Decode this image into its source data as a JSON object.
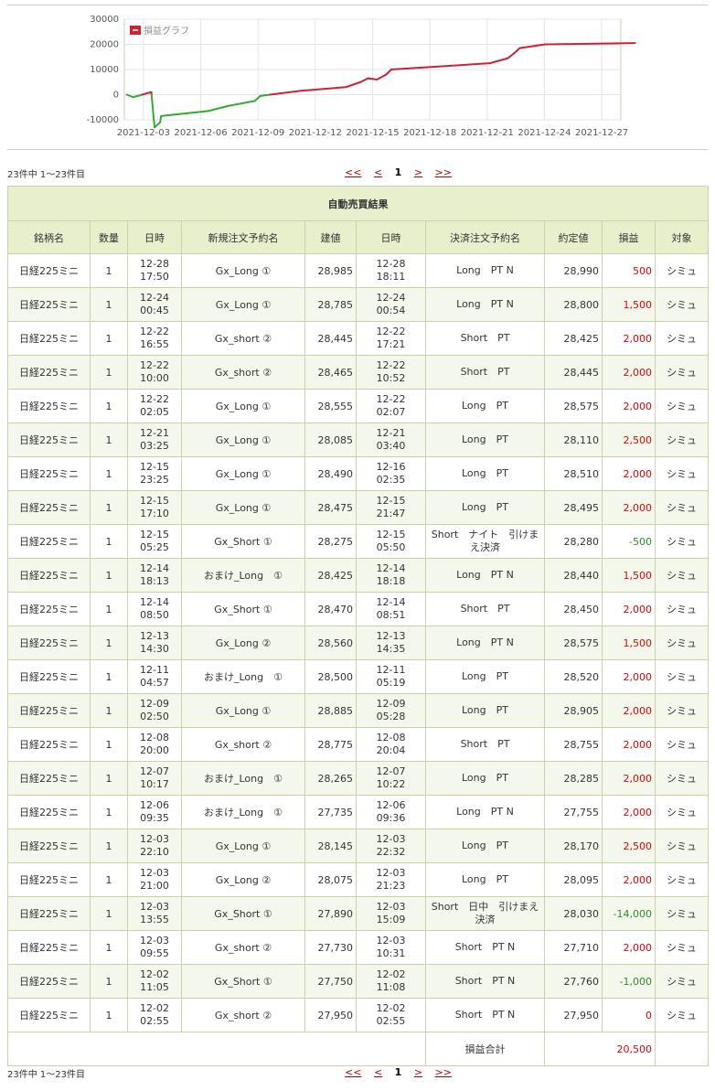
{
  "chart_data": {
    "type": "line",
    "legend": "損益グラフ",
    "legend_position": "top-left",
    "ylim": [
      -10000,
      30000
    ],
    "yticks": [
      30000,
      20000,
      10000,
      0,
      -10000
    ],
    "ytick_labels": [
      "30000",
      "20000",
      "10000",
      "0",
      "-10000"
    ],
    "xticks": [
      "2021-12-03",
      "2021-12-06",
      "2021-12-09",
      "2021-12-12",
      "2021-12-15",
      "2021-12-18",
      "2021-12-21",
      "2021-12-24",
      "2021-12-27"
    ],
    "xlim": [
      "2021-12-02",
      "2021-12-28"
    ],
    "series": [
      {
        "name": "損益グラフ",
        "points": [
          [
            "2021-12-02 02:55",
            0
          ],
          [
            "2021-12-02 11:05",
            -1000
          ],
          [
            "2021-12-03 09:55",
            1000
          ],
          [
            "2021-12-03 13:55",
            -13000
          ],
          [
            "2021-12-03 21:00",
            -11000
          ],
          [
            "2021-12-03 22:10",
            -8500
          ],
          [
            "2021-12-06 09:35",
            -6500
          ],
          [
            "2021-12-07 10:17",
            -4500
          ],
          [
            "2021-12-08 20:00",
            -2500
          ],
          [
            "2021-12-09 02:50",
            -500
          ],
          [
            "2021-12-11 04:57",
            1500
          ],
          [
            "2021-12-13 14:30",
            3000
          ],
          [
            "2021-12-14 08:50",
            5000
          ],
          [
            "2021-12-14 18:13",
            6500
          ],
          [
            "2021-12-15 05:25",
            6000
          ],
          [
            "2021-12-15 17:10",
            8000
          ],
          [
            "2021-12-15 23:25",
            10000
          ],
          [
            "2021-12-21 03:25",
            12500
          ],
          [
            "2021-12-22 02:05",
            14500
          ],
          [
            "2021-12-22 10:00",
            16500
          ],
          [
            "2021-12-22 16:55",
            18500
          ],
          [
            "2021-12-24 00:45",
            20000
          ],
          [
            "2021-12-28 17:50",
            20500
          ]
        ],
        "color_negative": "#33aa33",
        "color_positive": "#cc2233"
      }
    ],
    "grid": true
  },
  "pager": {
    "count_text": "23件中 1～23件目",
    "first": "<<",
    "prev": "<",
    "current": "1",
    "next": ">",
    "last": ">>"
  },
  "table": {
    "title": "自動売買結果",
    "headers": [
      "銘柄名",
      "数量",
      "日時",
      "新規注文予約名",
      "建値",
      "日時",
      "決済注文予約名",
      "約定値",
      "損益",
      "対象"
    ],
    "rows": [
      [
        "日経225ミニ",
        "1",
        "12-28\n17:50",
        "Gx_Long ①",
        "28,985",
        "12-28\n18:11",
        "Long　PT N",
        "28,990",
        "500",
        "シミュ"
      ],
      [
        "日経225ミニ",
        "1",
        "12-24\n00:45",
        "Gx_Long ①",
        "28,785",
        "12-24\n00:54",
        "Long　PT N",
        "28,800",
        "1,500",
        "シミュ"
      ],
      [
        "日経225ミニ",
        "1",
        "12-22\n16:55",
        "Gx_short ②",
        "28,445",
        "12-22\n17:21",
        "Short　PT",
        "28,425",
        "2,000",
        "シミュ"
      ],
      [
        "日経225ミニ",
        "1",
        "12-22\n10:00",
        "Gx_short ②",
        "28,465",
        "12-22\n10:52",
        "Short　PT",
        "28,445",
        "2,000",
        "シミュ"
      ],
      [
        "日経225ミニ",
        "1",
        "12-22\n02:05",
        "Gx_Long ①",
        "28,555",
        "12-22\n02:07",
        "Long　PT",
        "28,575",
        "2,000",
        "シミュ"
      ],
      [
        "日経225ミニ",
        "1",
        "12-21\n03:25",
        "Gx_Long ①",
        "28,085",
        "12-21\n03:40",
        "Long　PT",
        "28,110",
        "2,500",
        "シミュ"
      ],
      [
        "日経225ミニ",
        "1",
        "12-15\n23:25",
        "Gx_Long ①",
        "28,490",
        "12-16\n02:35",
        "Long　PT",
        "28,510",
        "2,000",
        "シミュ"
      ],
      [
        "日経225ミニ",
        "1",
        "12-15\n17:10",
        "Gx_Long ①",
        "28,475",
        "12-15\n21:47",
        "Long　PT",
        "28,495",
        "2,000",
        "シミュ"
      ],
      [
        "日経225ミニ",
        "1",
        "12-15\n05:25",
        "Gx_Short ①",
        "28,275",
        "12-15\n05:50",
        "Short　ナイト　引けま\nえ決済",
        "28,280",
        "-500",
        "シミュ"
      ],
      [
        "日経225ミニ",
        "1",
        "12-14\n18:13",
        "おまけ_Long　①",
        "28,425",
        "12-14\n18:18",
        "Long　PT N",
        "28,440",
        "1,500",
        "シミュ"
      ],
      [
        "日経225ミニ",
        "1",
        "12-14\n08:50",
        "Gx_Short ①",
        "28,470",
        "12-14\n08:51",
        "Short　PT",
        "28,450",
        "2,000",
        "シミュ"
      ],
      [
        "日経225ミニ",
        "1",
        "12-13\n14:30",
        "Gx_Long ②",
        "28,560",
        "12-13\n14:35",
        "Long　PT N",
        "28,575",
        "1,500",
        "シミュ"
      ],
      [
        "日経225ミニ",
        "1",
        "12-11\n04:57",
        "おまけ_Long　①",
        "28,500",
        "12-11\n05:19",
        "Long　PT",
        "28,520",
        "2,000",
        "シミュ"
      ],
      [
        "日経225ミニ",
        "1",
        "12-09\n02:50",
        "Gx_Long ①",
        "28,885",
        "12-09\n05:28",
        "Long　PT",
        "28,905",
        "2,000",
        "シミュ"
      ],
      [
        "日経225ミニ",
        "1",
        "12-08\n20:00",
        "Gx_short ②",
        "28,775",
        "12-08\n20:04",
        "Short　PT",
        "28,755",
        "2,000",
        "シミュ"
      ],
      [
        "日経225ミニ",
        "1",
        "12-07\n10:17",
        "おまけ_Long　①",
        "28,265",
        "12-07\n10:22",
        "Long　PT",
        "28,285",
        "2,000",
        "シミュ"
      ],
      [
        "日経225ミニ",
        "1",
        "12-06\n09:35",
        "おまけ_Long　①",
        "27,735",
        "12-06\n09:36",
        "Long　PT N",
        "27,755",
        "2,000",
        "シミュ"
      ],
      [
        "日経225ミニ",
        "1",
        "12-03\n22:10",
        "Gx_Long ①",
        "28,145",
        "12-03\n22:32",
        "Long　PT",
        "28,170",
        "2,500",
        "シミュ"
      ],
      [
        "日経225ミニ",
        "1",
        "12-03\n21:00",
        "Gx_Long ②",
        "28,075",
        "12-03\n21:23",
        "Long　PT",
        "28,095",
        "2,000",
        "シミュ"
      ],
      [
        "日経225ミニ",
        "1",
        "12-03\n13:55",
        "Gx_Short ①",
        "27,890",
        "12-03\n15:09",
        "Short　日中　引けまえ\n決済",
        "28,030",
        "-14,000",
        "シミュ"
      ],
      [
        "日経225ミニ",
        "1",
        "12-03\n09:55",
        "Gx_short ②",
        "27,730",
        "12-03\n10:31",
        "Short　PT N",
        "27,710",
        "2,000",
        "シミュ"
      ],
      [
        "日経225ミニ",
        "1",
        "12-02\n11:05",
        "Gx_Short ①",
        "27,750",
        "12-02\n11:08",
        "Short　PT N",
        "27,760",
        "-1,000",
        "シミュ"
      ],
      [
        "日経225ミニ",
        "1",
        "12-02\n02:55",
        "Gx_short ②",
        "27,950",
        "12-02\n02:55",
        "Short　PT N",
        "27,950",
        "0",
        "シミュ"
      ]
    ],
    "total_label": "損益合計",
    "total_value": "20,500"
  },
  "colors": {
    "positive": "#e00000",
    "negative": "#2e8b2e",
    "header_bg": "#e7efcd",
    "row_alt_bg": "#f4f8ec",
    "link": "#c00000"
  }
}
